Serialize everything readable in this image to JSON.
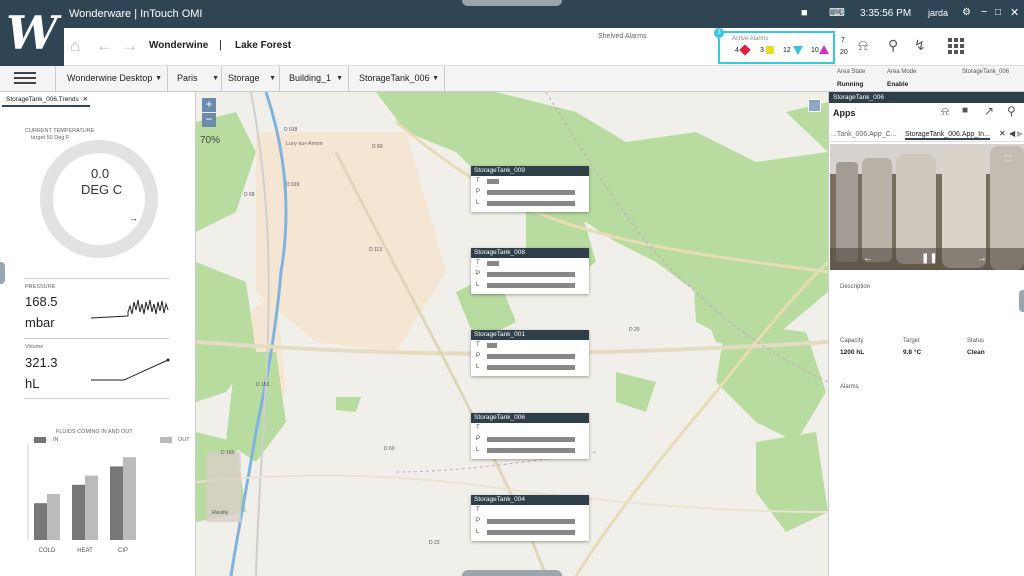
{
  "titlebar": {
    "title": "Wonderware | InTouch OMI",
    "time": "3:35:56 PM",
    "user": "jarda"
  },
  "nav": {
    "title": "Wonderwine",
    "separator": "|",
    "location": "Lake Forest",
    "shelved_label": "Shelved Alarms",
    "active_alarms_label": "Active Alarms",
    "active_alarms_badge": "3",
    "alarm_counts": {
      "critical": "4",
      "high": "3",
      "medium": "12",
      "low": "10"
    },
    "shelved_counts": {
      "top": "7",
      "bottom": "20"
    }
  },
  "breadcrumb": [
    "Wonderwine Desktop",
    "Paris",
    "Storage",
    "Building_1",
    "StorageTank_006"
  ],
  "area": {
    "state_label": "Area State",
    "state_value": "Running",
    "mode_label": "Area Mode",
    "mode_value": "Enable",
    "object_label": "StorageTank_006"
  },
  "left": {
    "tab": "StorageTank_006.Trends",
    "current_temp_label": "CURRENT TEMPERATURE",
    "target_label": "target 50 Deg F",
    "temp_value": "0.0",
    "temp_unit": "DEG C",
    "pressure_label": "PRESSURE",
    "pressure_value": "168.5",
    "pressure_unit": "mbar",
    "volume_label": "Volume",
    "volume_value": "321.3",
    "volume_unit": "hL",
    "fluids_title": "FLUIDS COMING IN AND OUT",
    "legend_in": "IN",
    "legend_out": "OUT",
    "categories": [
      "COLD",
      "HEAT",
      "CIP"
    ]
  },
  "map": {
    "zoom_in": "+",
    "zoom_out": "−",
    "zoom_level": "70%",
    "road_labels": [
      "D 918",
      "D 60",
      "D 68",
      "D 113",
      "D 20",
      "D 165",
      "D 23",
      "D 919",
      "D 153",
      "D 60"
    ],
    "place_labels": [
      "Lury-sur-Arnon",
      "Reuilly"
    ],
    "tanks": [
      {
        "name": "StorageTank_009",
        "t": 0.12,
        "p": 0.92,
        "l": 0.92
      },
      {
        "name": "StorageTank_008",
        "t": 0.12,
        "p": 0.92,
        "l": 0.92
      },
      {
        "name": "StorageTank_001",
        "t": 0.1,
        "p": 0.92,
        "l": 0.92
      },
      {
        "name": "StorageTank_006",
        "t": 0,
        "p": 0.92,
        "l": 0.92
      },
      {
        "name": "StorageTank_004",
        "t": 0,
        "p": 0.92,
        "l": 0.92
      }
    ],
    "row_labels": [
      "T",
      "P",
      "L"
    ]
  },
  "right": {
    "object_header": "StorageTank_006",
    "apps_label": "Apps",
    "tab1": "...Tank_006.App_C...",
    "tab2": "StorageTank_006.App_In...",
    "description_label": "Description",
    "capacity_label": "Capacity",
    "capacity_value": "1200 hL",
    "target_label": "Target",
    "target_value": "9.8 °C",
    "status_label": "Status",
    "status_value": "Clean",
    "alarms_label": "Alarms"
  },
  "fluids_chart": {
    "chart_data": {
      "type": "bar",
      "categories": [
        "COLD",
        "HEAT",
        "CIP"
      ],
      "series": [
        {
          "name": "IN",
          "values": [
            40,
            60,
            80
          ]
        },
        {
          "name": "OUT",
          "values": [
            50,
            70,
            90
          ]
        }
      ],
      "ylim": [
        0,
        100
      ]
    }
  },
  "colors": {
    "titlebar": "#2f4554",
    "alarm_box": "#38c6e8",
    "crit": "#e0203a",
    "high": "#f0d72a",
    "medium": "#2fc7e0",
    "low": "#d12fc7",
    "map_green": "#b8dba0"
  }
}
